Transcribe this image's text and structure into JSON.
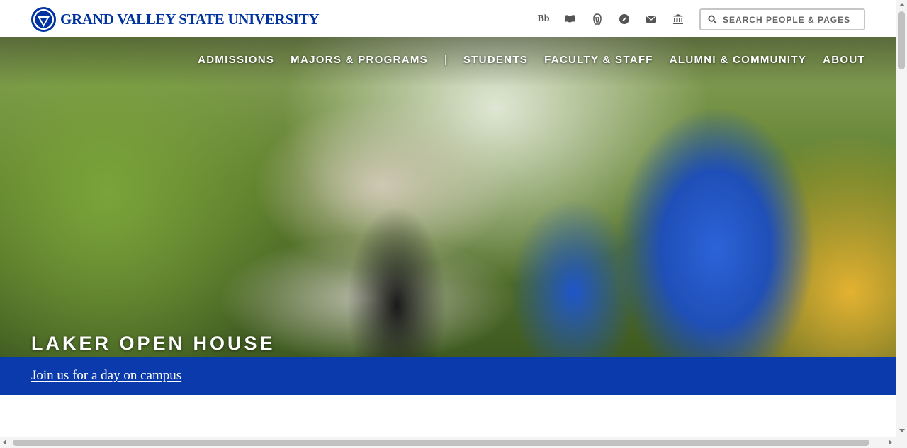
{
  "header": {
    "logo_text": "GRAND VALLEY STATE UNIVERSITY",
    "brand_color": "#0032a0",
    "utility_icons": [
      {
        "name": "blackboard-icon",
        "label": "Bb"
      },
      {
        "name": "flag-icon"
      },
      {
        "name": "laker-icon"
      },
      {
        "name": "compass-icon"
      },
      {
        "name": "mail-icon"
      },
      {
        "name": "bank-icon"
      }
    ],
    "search": {
      "placeholder": "SEARCH PEOPLE & PAGES",
      "value": ""
    }
  },
  "nav": {
    "items": [
      "ADMISSIONS",
      "MAJORS & PROGRAMS",
      "STUDENTS",
      "FACULTY & STAFF",
      "ALUMNI & COMMUNITY",
      "ABOUT"
    ],
    "separator": "|"
  },
  "hero": {
    "title": "LAKER OPEN HOUSE",
    "link_text": "Join us for a day on campus",
    "band_color": "#0a3aab"
  }
}
